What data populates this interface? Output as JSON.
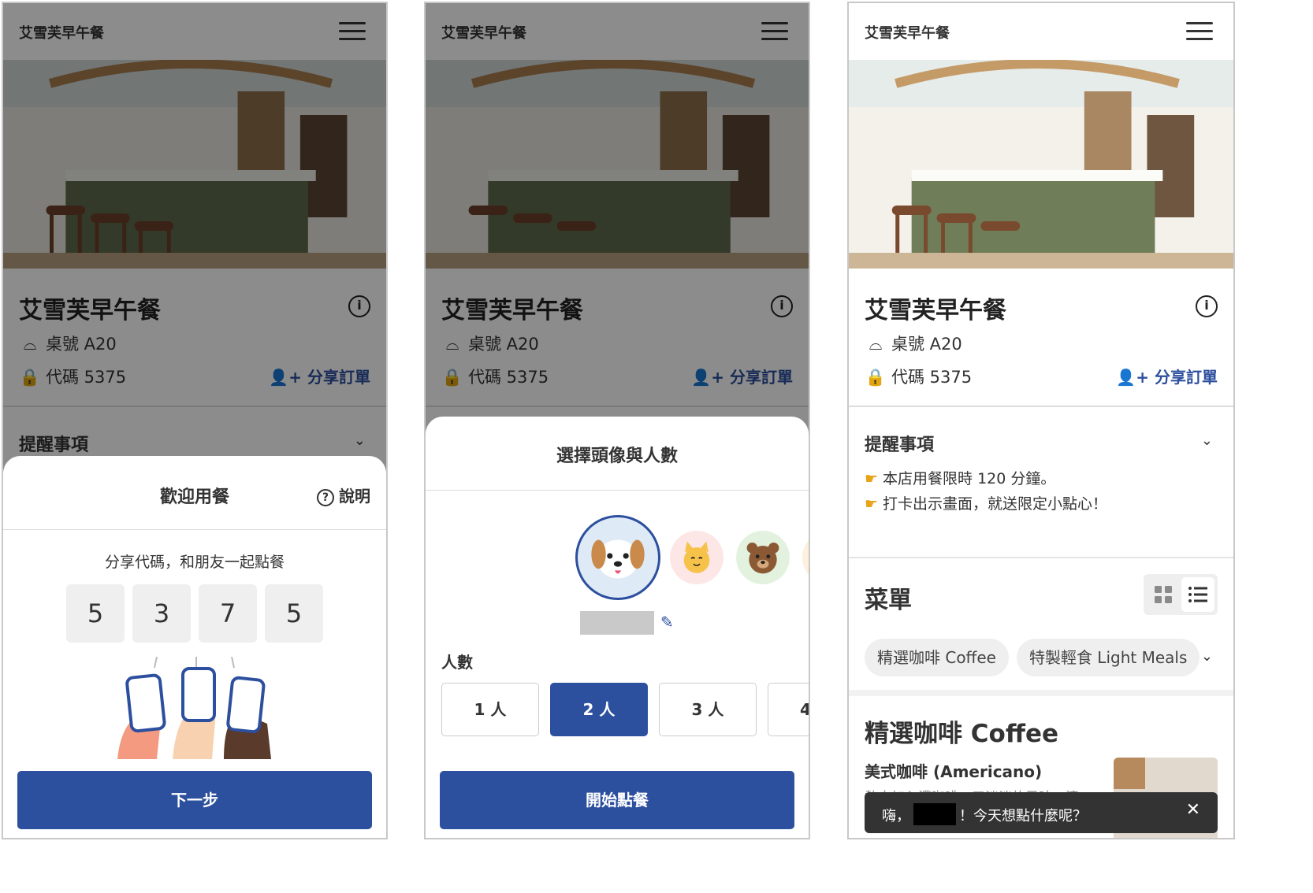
{
  "header": {
    "brand": "艾雪芙早午餐"
  },
  "shop": {
    "name": "艾雪芙早午餐",
    "table_label": "桌號 A20",
    "code_label": "代碼 5375",
    "share_label": "分享訂單"
  },
  "notice": {
    "title": "提醒事項",
    "lines": [
      "本店用餐限時 120 分鐘。",
      "打卡出示畫面，就送限定小點心！"
    ]
  },
  "welcome_sheet": {
    "title": "歡迎用餐",
    "help_label": "說明",
    "subtitle": "分享代碼，和朋友一起點餐",
    "code_digits": [
      "5",
      "3",
      "7",
      "5"
    ],
    "next_label": "下一步"
  },
  "avatar_sheet": {
    "title": "選擇頭像與人數",
    "people_label": "人數",
    "people_options": [
      "1 人",
      "2 人",
      "3 人",
      "4"
    ],
    "selected_people": "2 人",
    "avatars": [
      "dog-icon",
      "cat-icon",
      "bear-icon"
    ],
    "start_label": "開始點餐"
  },
  "menu": {
    "title": "菜單",
    "chips": [
      "精選咖啡 Coffee",
      "特製輕食 Light Meals"
    ],
    "category_title": "精選咖啡 Coffee",
    "item_name": "美式咖啡 (Americano)",
    "item_desc": "熱水加入濃咖啡，口淡淡的風味，清"
  },
  "toast": {
    "greeting": "嗨，",
    "question": "！今天想點什麼呢？"
  },
  "colors": {
    "primary": "#2c4f9e",
    "overlay": "rgba(0,0,0,0.45)"
  }
}
